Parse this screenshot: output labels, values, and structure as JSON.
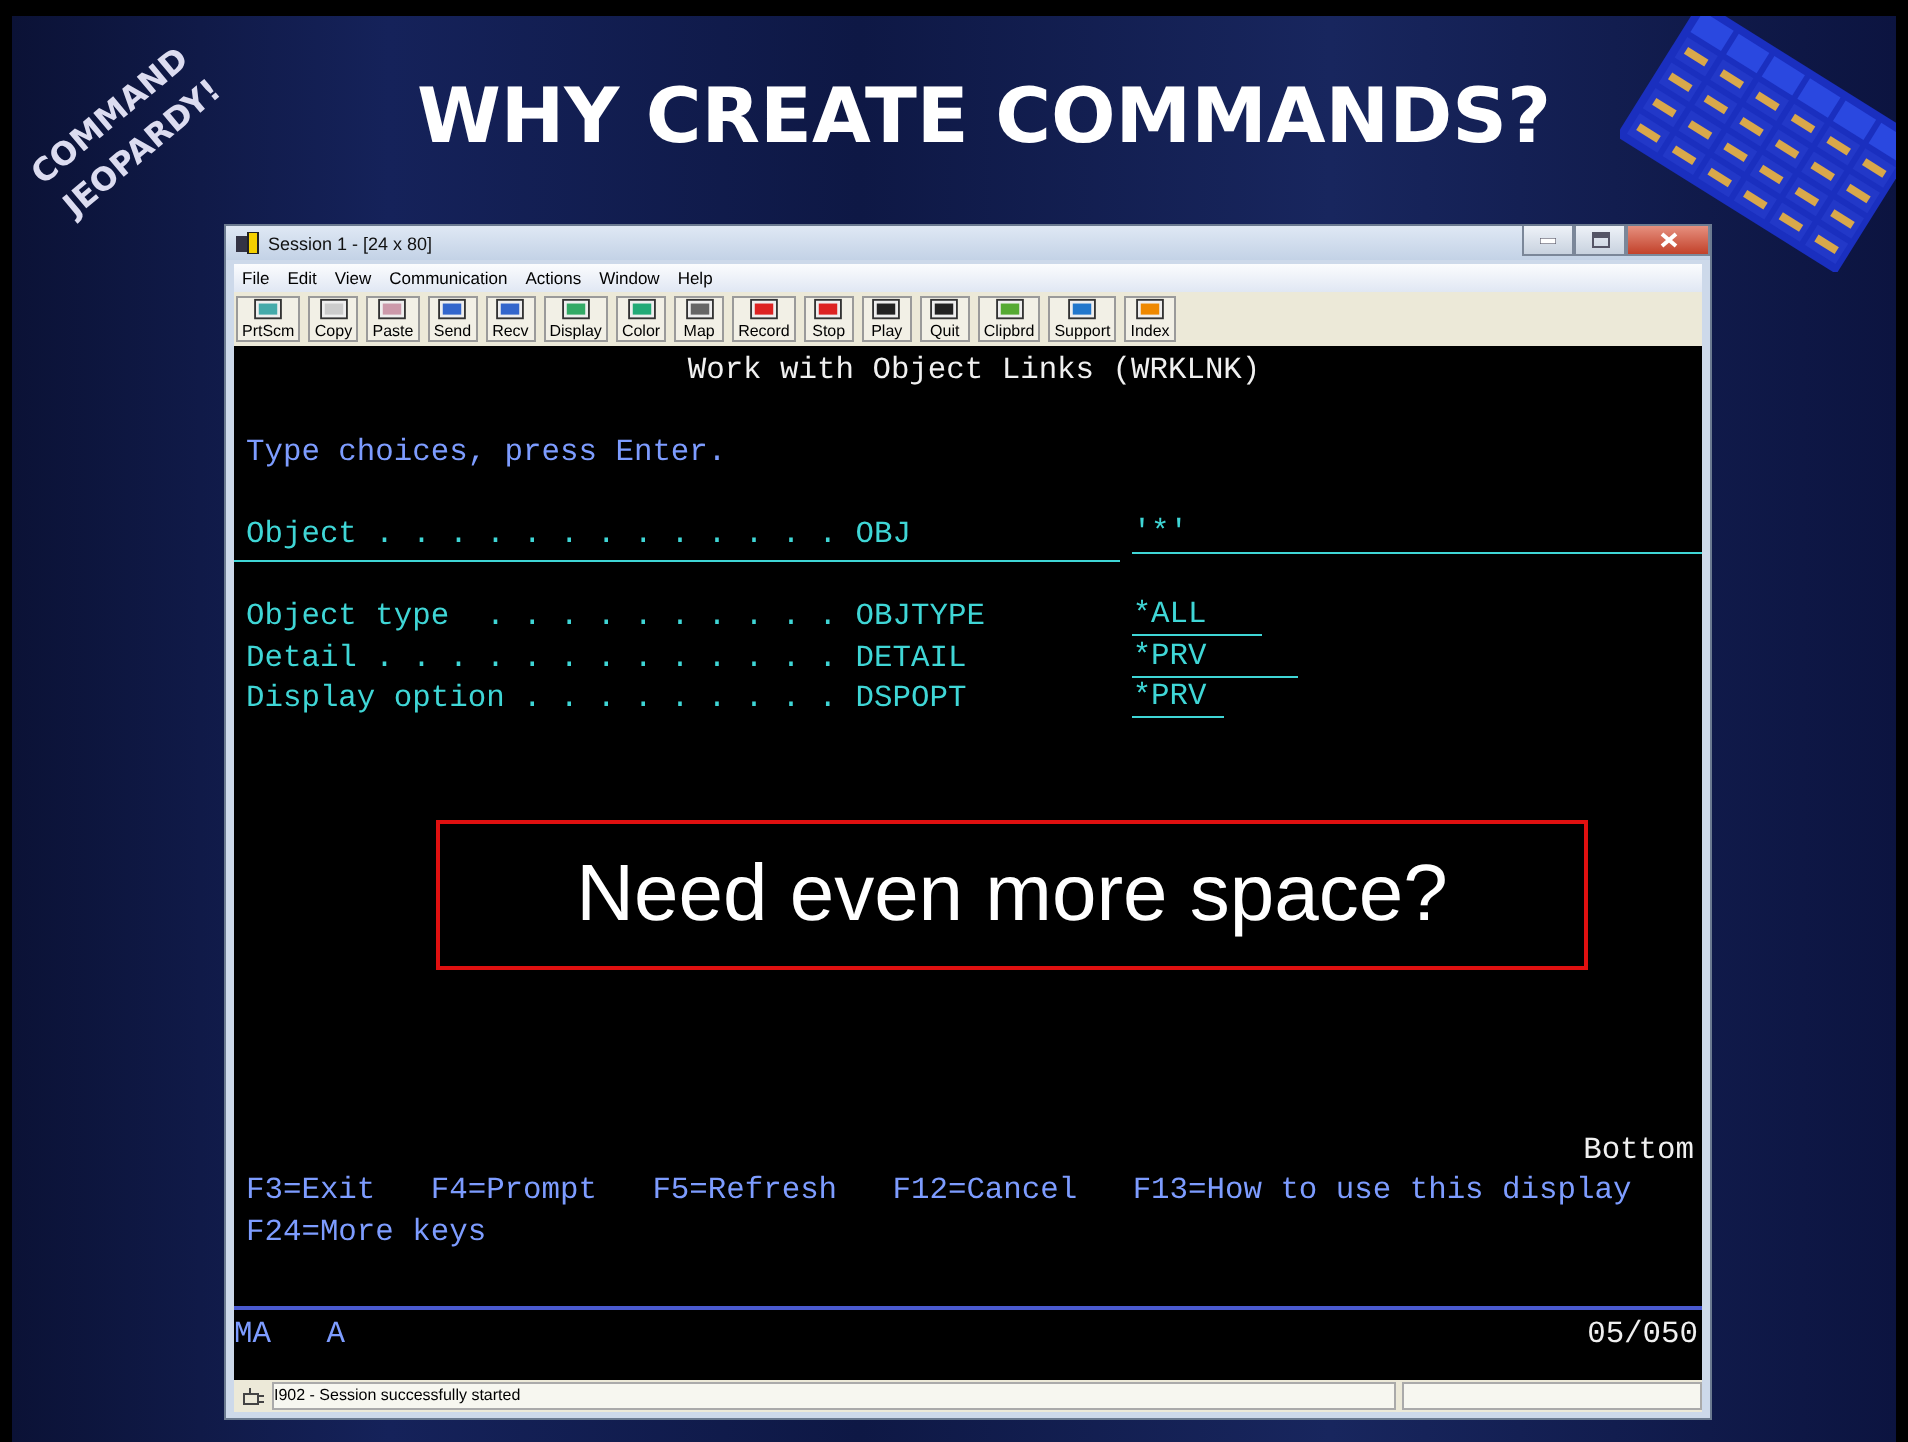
{
  "slide": {
    "logo": [
      "COMMAND",
      "JEOPARDY!"
    ],
    "title": "WHY CREATE COMMANDS?"
  },
  "window": {
    "title": "Session 1 - [24 x 80]",
    "menu": [
      "File",
      "Edit",
      "View",
      "Communication",
      "Actions",
      "Window",
      "Help"
    ],
    "toolbar": [
      "PrtScm",
      "Copy",
      "Paste",
      "Send",
      "Recv",
      "Display",
      "Color",
      "Map",
      "Record",
      "Stop",
      "Play",
      "Quit",
      "Clipbrd",
      "Support",
      "Index"
    ]
  },
  "screen": {
    "title": "Work with Object Links (WRKLNK)",
    "instruction": "Type choices, press Enter.",
    "fields": [
      {
        "label": "Object . . . . . . . . . . . . .",
        "keyword": "OBJ",
        "value": "'*'"
      },
      {
        "label": "Object type  . . . . . . . . . .",
        "keyword": "OBJTYPE",
        "value": "*ALL"
      },
      {
        "label": "Detail . . . . . . . . . . . . .",
        "keyword": "DETAIL",
        "value": "*PRV"
      },
      {
        "label": "Display option . . . . . . . . .",
        "keyword": "DSPOPT",
        "value": "*PRV"
      }
    ],
    "position": "Bottom",
    "function_keys": [
      "F3=Exit",
      "F4=Prompt",
      "F5=Refresh",
      "F12=Cancel",
      "F13=How to use this display"
    ],
    "more_keys": "F24=More keys",
    "oia": {
      "mode": "MA",
      "input": "A",
      "cursor": "05/050"
    }
  },
  "callout": "Need even more space?",
  "status_bar": {
    "message": "I902 - Session successfully started"
  }
}
